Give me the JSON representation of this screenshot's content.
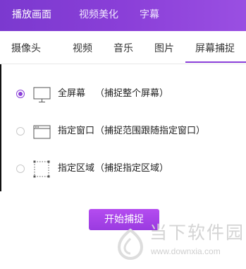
{
  "top_tabs": [
    {
      "label": "播放画面",
      "active": true
    },
    {
      "label": "视频美化",
      "active": false
    },
    {
      "label": "字幕",
      "active": false
    }
  ],
  "sub_tabs": [
    {
      "label": "摄像头"
    },
    {
      "label": "视频"
    },
    {
      "label": "音乐"
    },
    {
      "label": "图片"
    },
    {
      "label": "屏幕捕捉",
      "active": true
    }
  ],
  "capture_options": [
    {
      "label": "全屏幕",
      "description": "（捕捉整个屏幕）",
      "checked": true,
      "icon": "monitor-icon"
    },
    {
      "label": "指定窗口",
      "description": "（捕捉范围跟随指定窗口）",
      "checked": false,
      "icon": "window-icon"
    },
    {
      "label": "指定区域",
      "description": "（捕捉指定区域）",
      "checked": false,
      "icon": "dashed-region-icon"
    }
  ],
  "start_button": {
    "label": "开始捕捉"
  },
  "watermark": {
    "text": "当下软件园",
    "url": "www.downxia.com"
  },
  "colors": {
    "accent": "#8a3fd8",
    "button": "#a845e8",
    "topbar": "#8a3fd8"
  }
}
